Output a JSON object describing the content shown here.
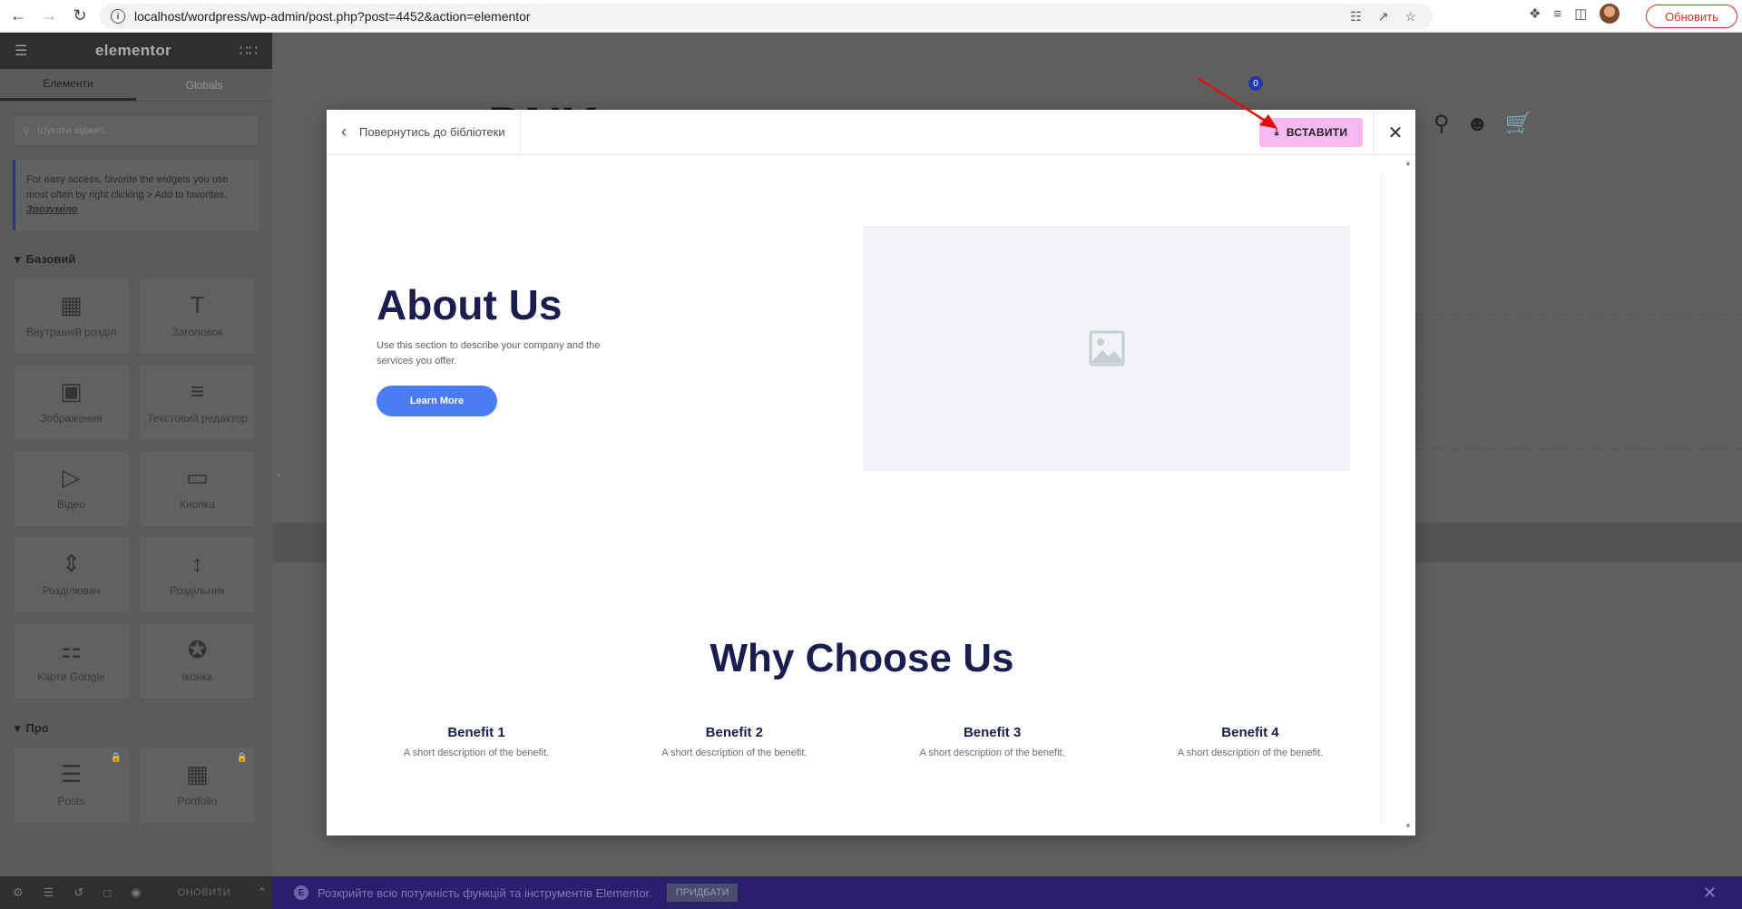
{
  "browser": {
    "url": "localhost/wordpress/wp-admin/post.php?post=4452&action=elementor",
    "update_label": "Обновить",
    "icons": [
      "back-icon",
      "forward-icon",
      "reload-icon",
      "info-icon",
      "translate-icon",
      "share-icon",
      "star-icon",
      "extensions-icon",
      "reading-list-icon",
      "sidepanel-icon"
    ]
  },
  "panel": {
    "logo": "elementor",
    "tabs": [
      "Елементи",
      "Globals"
    ],
    "search_placeholder": "Шукати віджет...",
    "tip_text": "For easy access, favorite the widgets you use most often by right clicking > Add to favorites.",
    "tip_link": "Зрозуміло",
    "categories": [
      {
        "title": "Базовий",
        "widgets": [
          {
            "label": "Внутрішній розділ",
            "icon": "inner-section-icon"
          },
          {
            "label": "Заголовок",
            "icon": "heading-icon"
          },
          {
            "label": "Зображення",
            "icon": "image-icon"
          },
          {
            "label": "Текстовий редактор",
            "icon": "text-editor-icon"
          },
          {
            "label": "Відео",
            "icon": "video-icon"
          },
          {
            "label": "Кнопка",
            "icon": "button-icon"
          },
          {
            "label": "Розділювач",
            "icon": "divider-icon"
          },
          {
            "label": "Роздільник",
            "icon": "spacer-icon"
          },
          {
            "label": "Карти Google",
            "icon": "google-maps-icon"
          },
          {
            "label": "Іконка",
            "icon": "icon-widget-icon"
          }
        ]
      },
      {
        "title": "Про",
        "widgets": [
          {
            "label": "Posts",
            "icon": "posts-icon"
          },
          {
            "label": "Portfolio",
            "icon": "portfolio-icon"
          }
        ]
      }
    ],
    "footer": {
      "publish_label": "ОНОВИТИ"
    }
  },
  "preview": {
    "logo_text": "DNK",
    "cart_count": "0"
  },
  "promo": {
    "text": "Розкрийте всю потужність функцій та інструментів Elementor.",
    "button": "ПРИДБАТИ"
  },
  "modal": {
    "back_label": "Повернутись до бібліотеки",
    "insert_label": "ВСТАВИТИ",
    "accent_color": "#f6baf1",
    "template": {
      "about_title": "About Us",
      "about_desc": "Use this section to describe your company and the services you offer.",
      "learn_more": "Learn More",
      "why_title": "Why Choose Us",
      "benefits": [
        {
          "title": "Benefit 1",
          "desc": "A short description of the benefit."
        },
        {
          "title": "Benefit 2",
          "desc": "A short description of the benefit."
        },
        {
          "title": "Benefit 3",
          "desc": "A short description of the benefit."
        },
        {
          "title": "Benefit 4",
          "desc": "A short description of the benefit."
        }
      ]
    }
  }
}
